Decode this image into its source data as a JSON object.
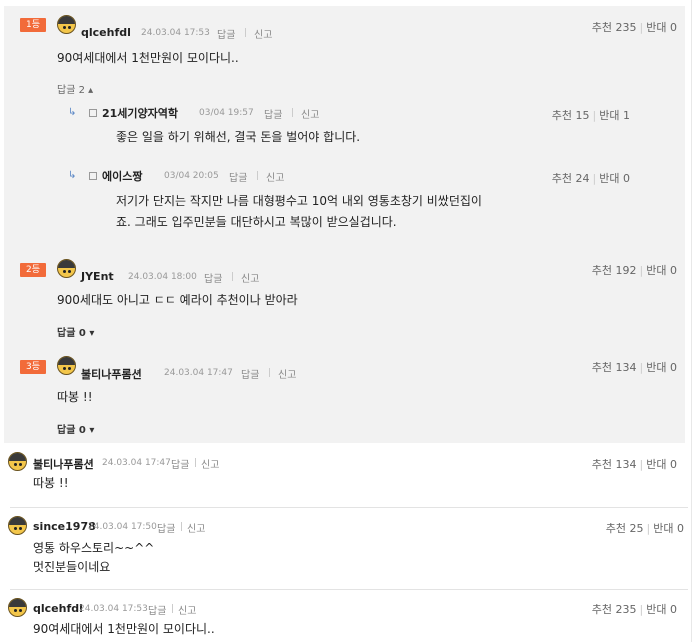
{
  "common": {
    "reply": "답글",
    "report": "신고",
    "up_label": "추천",
    "down_label": "반대"
  },
  "best_comments": [
    {
      "rank": "1등",
      "nickname": "qlcehfdl",
      "date": "24.03.04 17:53",
      "text": "90여세대에서 1천만원이 모이다니..",
      "up": "235",
      "down": "0",
      "reply_toggle": "답글 2 ▴",
      "replies": [
        {
          "nickname": "21세기양자역학",
          "date": "03/04 19:57",
          "up": "15",
          "down": "1",
          "text": [
            "좋은 일을 하기 위해선, 결국 돈을 벌어야 합니다."
          ]
        },
        {
          "nickname": "에이스짱",
          "date": "03/04 20:05",
          "up": "24",
          "down": "0",
          "text": [
            "저기가 단지는 작지만 나름 대형평수고 10억 내외 영통초창기 비쌌던집이",
            "죠. 그래도 입주민분들 대단하시고 복많이 받으실겁니다."
          ]
        }
      ]
    },
    {
      "rank": "2등",
      "nickname": "JYEnt",
      "date": "24.03.04 18:00",
      "text": "900세대도 아니고 ㄷㄷ 예라이 추천이나 받아라",
      "up": "192",
      "down": "0",
      "reply_toggle": "답글 0 ▾"
    },
    {
      "rank": "3등",
      "nickname": "불티나푸롬션",
      "date": "24.03.04 17:47",
      "text": "따봉 !!",
      "up": "134",
      "down": "0",
      "reply_toggle": "답글 0 ▾"
    }
  ],
  "comments": [
    {
      "nickname": "불티나푸롬션",
      "date": "24.03.04 17:47",
      "text": [
        "따봉 !!"
      ],
      "up": "134",
      "down": "0"
    },
    {
      "nickname": "since1978",
      "date": "24.03.04 17:50",
      "text": [
        "영통 하우스토리~~^^",
        "멋진분들이네요"
      ],
      "up": "25",
      "down": "0"
    },
    {
      "nickname": "qlcehfdl",
      "date": "24.03.04 17:53",
      "text": [
        "90여세대에서 1천만원이 모이다니.."
      ],
      "up": "235",
      "down": "0"
    }
  ]
}
